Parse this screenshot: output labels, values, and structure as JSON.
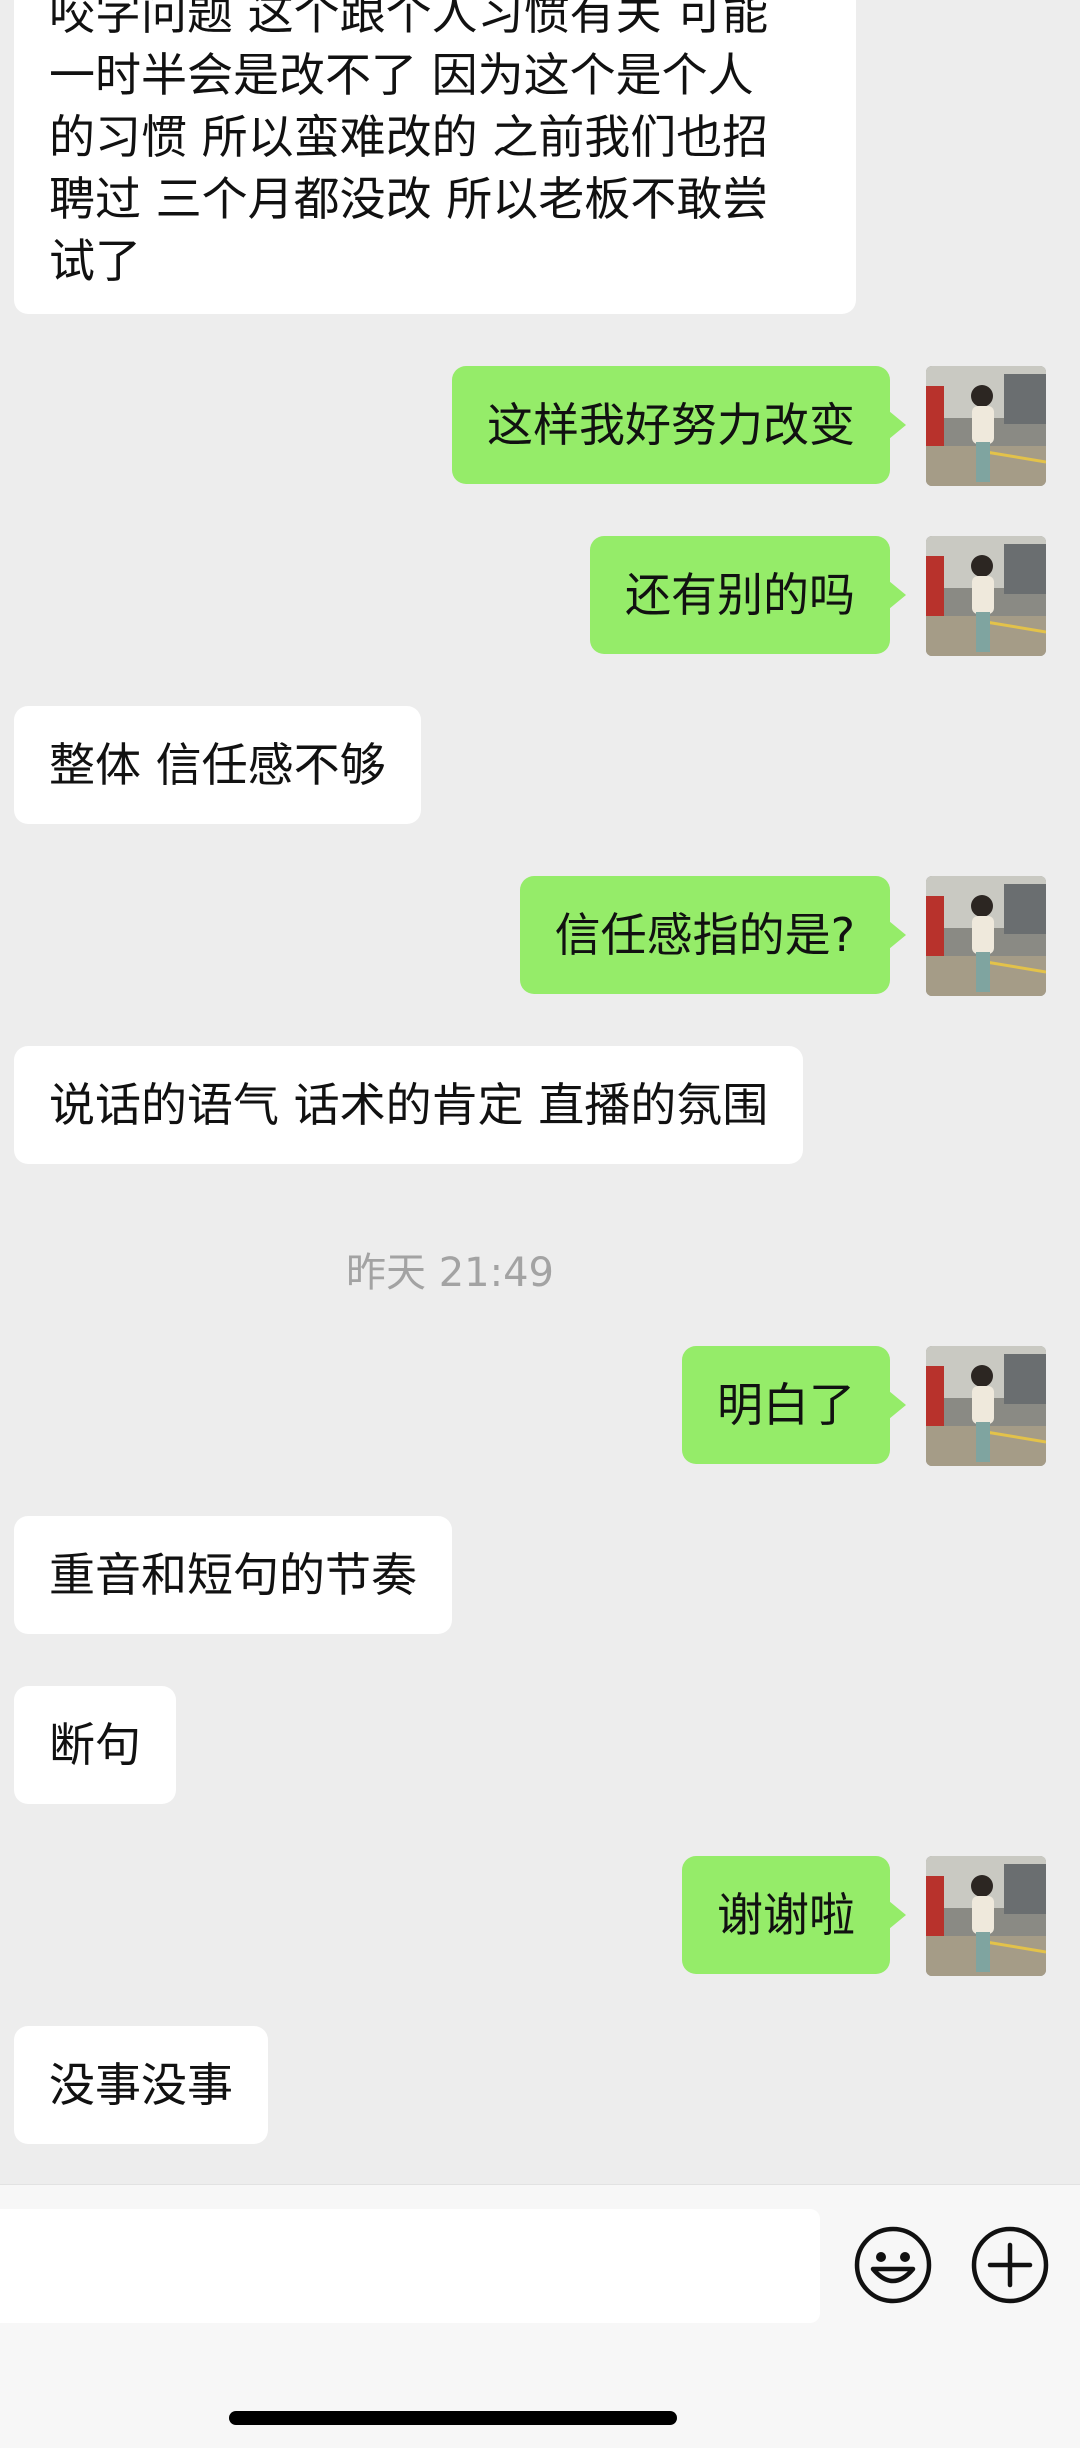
{
  "messages": [
    {
      "side": "in",
      "lines": [
        "咬字问题 这个跟个人习惯有关 可能",
        "一时半会是改不了 因为这个是个人",
        "的习惯 所以蛮难改的 之前我们也招",
        "聘过 三个月都没改 所以老板不敢尝",
        "试了"
      ]
    },
    {
      "side": "out",
      "text": "这样我好努力改变"
    },
    {
      "side": "out",
      "text": "还有别的吗"
    },
    {
      "side": "in",
      "text": "整体 信任感不够"
    },
    {
      "side": "out",
      "text": "信任感指的是?"
    },
    {
      "side": "in",
      "text": "说话的语气 话术的肯定 直播的氛围"
    },
    {
      "side": "out",
      "text": "明白了"
    },
    {
      "side": "in",
      "text": "重音和短句的节奏"
    },
    {
      "side": "in",
      "text": "断句"
    },
    {
      "side": "out",
      "text": "谢谢啦"
    },
    {
      "side": "in",
      "text": "没事没事"
    }
  ],
  "timestamp": "昨天 21:49",
  "input_bar": {
    "emoji_icon": "smiley-face-icon",
    "plus_icon": "plus-circle-icon"
  },
  "colors": {
    "outgoing_bubble": "#95ec69",
    "incoming_bubble": "#ffffff",
    "background": "#ededed"
  }
}
